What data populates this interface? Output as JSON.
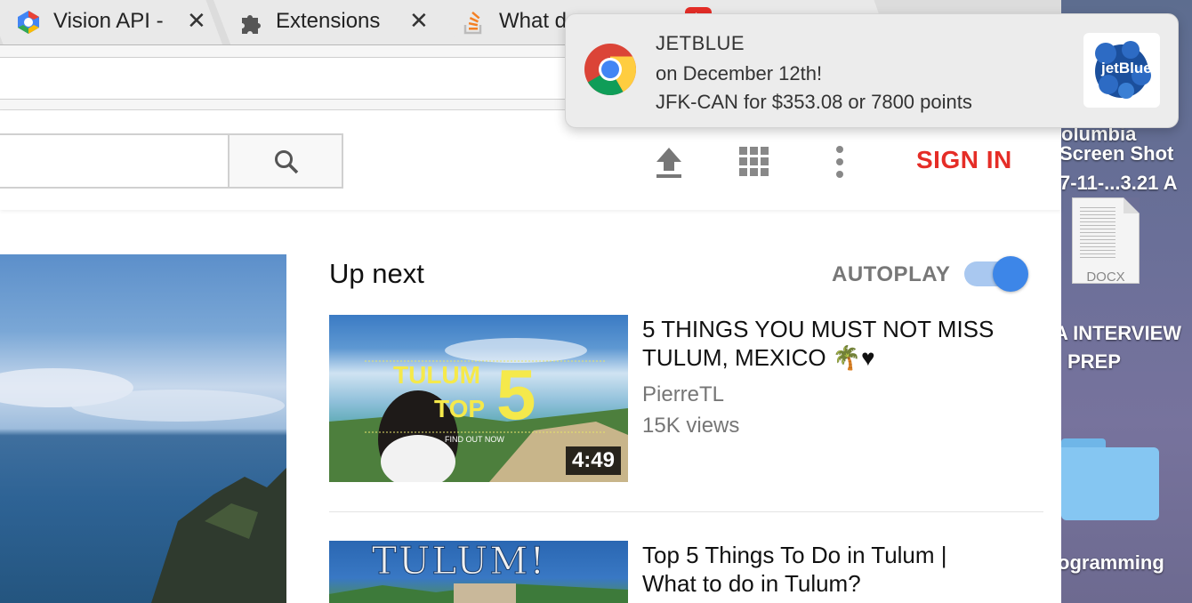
{
  "tabs": [
    {
      "label": "Vision API -",
      "close": "✕",
      "icon": "google-cloud-icon"
    },
    {
      "label": "Extensions",
      "close": "✕",
      "icon": "puzzle-icon"
    },
    {
      "label": "What d",
      "icon": "stackoverflow-icon"
    },
    {
      "label": "",
      "icon": "youtube-icon"
    }
  ],
  "notification": {
    "app_name": "JETBLUE",
    "line2": "on December 12th!",
    "line3": "JFK-CAN for $353.08 or 7800 points",
    "logo_text": "jetBlue"
  },
  "header": {
    "sign_in": "SIGN IN",
    "icons": [
      "upload-icon",
      "apps-grid-icon",
      "more-vert-icon",
      "search-icon"
    ]
  },
  "up_next": {
    "heading": "Up next",
    "autoplay_label": "AUTOPLAY",
    "autoplay_on": true
  },
  "videos": [
    {
      "title_line1": "5 THINGS YOU MUST NOT MISS",
      "title_line2": "TULUM, MEXICO 🌴♥",
      "channel": "PierreTL",
      "views": "15K views",
      "duration": "4:49",
      "thumb_text1": "TULUM",
      "thumb_text2": "TOP",
      "thumb_num": "5",
      "thumb_small": "FIND OUT NOW"
    },
    {
      "title_line1": "Top 5 Things To Do in Tulum |",
      "title_line2": "What to do in Tulum?",
      "thumb_text1": "TULUM!"
    }
  ],
  "desktop": {
    "label1": "olumbia",
    "label2": "Screen Shot",
    "label3": "7-11-...3.21 A",
    "docx_ext": "DOCX",
    "label4": "A INTERVIEW",
    "label5": "PREP",
    "label6": "ogramming"
  },
  "colors": {
    "sign_in": "#e52d27",
    "toggle_knob": "#3d86e8",
    "toggle_track": "#a9c8f0"
  }
}
